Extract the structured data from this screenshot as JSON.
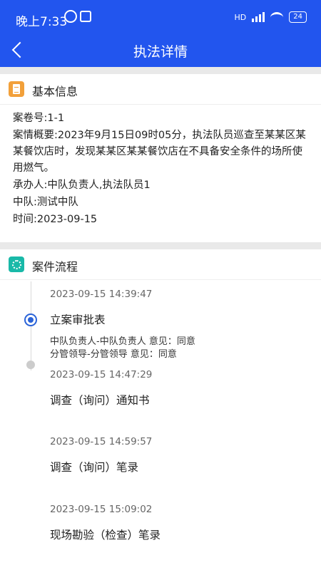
{
  "status": {
    "time": "晚上7:33",
    "network": "HD",
    "battery": "24"
  },
  "header": {
    "title": "执法详情"
  },
  "basic": {
    "section_title": "基本信息",
    "case_no": "案卷号:1-1",
    "summary": "案情概要:2023年9月15日09时05分，执法队员巡查至某某区某某餐饮店时，发现某某区某某餐饮店在不具备安全条件的场所使用燃气。",
    "handler": "承办人:中队负责人,执法队员1",
    "team": "中队:测试中队",
    "time": "时间:2023-09-15"
  },
  "process": {
    "section_title": "案件流程",
    "steps": [
      {
        "time": "2023-09-15 14:39:47",
        "title": "立案审批表",
        "opinions": [
          "中队负责人-中队负责人 意见：同意",
          "分管领导-分管领导 意见：同意"
        ]
      },
      {
        "time": "2023-09-15 14:47:29",
        "title": "调查（询问）通知书"
      },
      {
        "time": "2023-09-15 14:59:57",
        "title": "调查（询问）笔录"
      },
      {
        "time": "2023-09-15 15:09:02",
        "title": "现场勘验（检查）笔录"
      }
    ]
  }
}
